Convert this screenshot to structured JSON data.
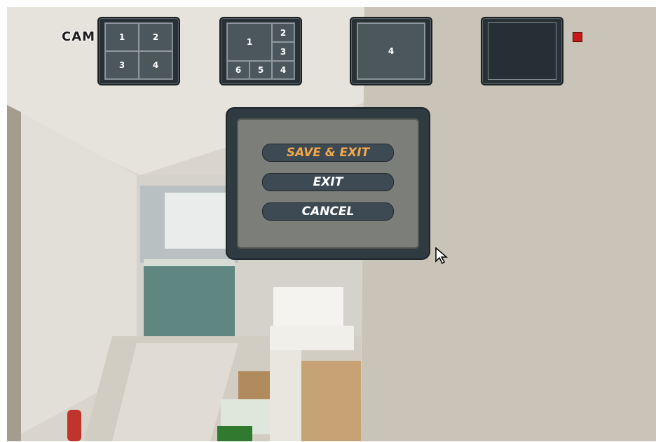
{
  "camera_label": "CAM",
  "layout_buttons": [
    {
      "name": "quad",
      "cells": [
        "1",
        "2",
        "3",
        "4"
      ]
    },
    {
      "name": "six",
      "cells": [
        "1",
        "2",
        "3",
        "6",
        "5",
        "4"
      ]
    },
    {
      "name": "single",
      "cells": [
        "4"
      ]
    },
    {
      "name": "blank",
      "cells": []
    }
  ],
  "dialog": {
    "save_exit_label": "SAVE & EXIT",
    "exit_label": "EXIT",
    "cancel_label": "CANCEL",
    "highlighted": "SAVE & EXIT"
  },
  "colors": {
    "highlight_text": "#f2a84a",
    "record_indicator": "#c81818",
    "button_fill": "#3d4a53"
  },
  "icons": {
    "record": "record-indicator-icon",
    "pointer": "mouse-cursor-icon"
  }
}
